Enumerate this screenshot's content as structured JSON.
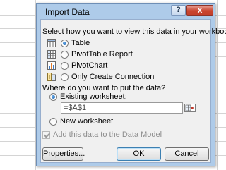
{
  "dialog": {
    "title": "Import Data",
    "help_label": "?",
    "close_label": "x"
  },
  "view_section": {
    "heading": "Select how you want to view this data in your workbook.",
    "options": [
      {
        "label": "Table",
        "selected": true,
        "icon": "table-icon"
      },
      {
        "label": "PivotTable Report",
        "selected": false,
        "icon": "pivottable-icon"
      },
      {
        "label": "PivotChart",
        "selected": false,
        "icon": "pivotchart-icon"
      },
      {
        "label": "Only Create Connection",
        "selected": false,
        "icon": "connection-icon"
      }
    ]
  },
  "destination_section": {
    "heading": "Where do you want to put the data?",
    "existing_label": "Existing worksheet:",
    "existing_selected": true,
    "cell_reference": "=$A$1",
    "new_label": "New worksheet",
    "new_selected": false
  },
  "data_model": {
    "label": "Add this data to the Data Model",
    "checked": true,
    "disabled": true
  },
  "buttons": {
    "properties": "Properties...",
    "ok": "OK",
    "cancel": "Cancel"
  },
  "colors": {
    "dialog_frame": "#aecbe9",
    "client_bg": "#f0f0f0",
    "close_red": "#c9452f",
    "radio_blue": "#1e5da8"
  }
}
